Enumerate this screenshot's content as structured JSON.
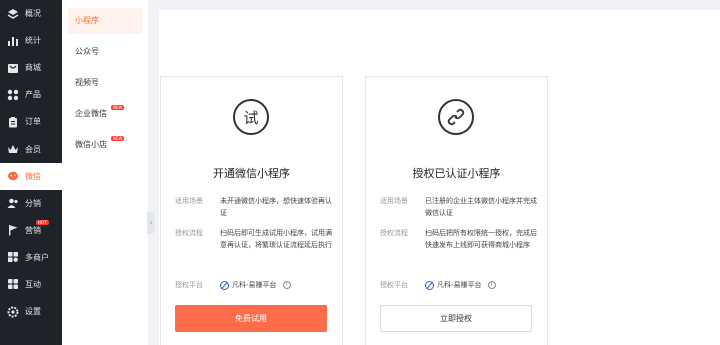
{
  "nav": {
    "items": [
      {
        "label": "概况",
        "icon": "layers-icon"
      },
      {
        "label": "统计",
        "icon": "bar-chart-icon"
      },
      {
        "label": "商城",
        "icon": "store-icon"
      },
      {
        "label": "产品",
        "icon": "grid-icon"
      },
      {
        "label": "订单",
        "icon": "clipboard-icon"
      },
      {
        "label": "会员",
        "icon": "crown-icon"
      },
      {
        "label": "微信",
        "icon": "wechat-icon"
      },
      {
        "label": "分销",
        "icon": "users-icon"
      },
      {
        "label": "营销",
        "icon": "flag-icon",
        "badge": "HOT"
      },
      {
        "label": "多商户",
        "icon": "shops-icon"
      },
      {
        "label": "互动",
        "icon": "apps-icon"
      },
      {
        "label": "设置",
        "icon": "gear-icon"
      }
    ],
    "active": "微信"
  },
  "submenu": {
    "items": [
      {
        "label": "小程序"
      },
      {
        "label": "公众号"
      },
      {
        "label": "视频号"
      },
      {
        "label": "企业微信",
        "badge": "NEW"
      },
      {
        "label": "微信小店",
        "badge": "NEW"
      }
    ],
    "active": "小程序"
  },
  "cards": [
    {
      "badge_char": "试",
      "title": "开通微信小程序",
      "scene_label": "适用场景",
      "scene": "未开通微信小程序，想快速体验再认证",
      "flow_label": "授权流程",
      "flow": "扫码后即可生成试用小程序，试用满意再认证，将繁琐认证流程延后执行",
      "platform_label": "授权平台",
      "platform": "凡科-易赚平台",
      "button": "免费试用"
    },
    {
      "badge_icon": "link-icon",
      "title": "授权已认证小程序",
      "scene_label": "适用场景",
      "scene": "已注册的企业主体微信小程序并完成微信认证",
      "flow_label": "授权流程",
      "flow": "扫码后把所有权限统一授权，完成后快速发布上线即可获得商城小程序",
      "platform_label": "授权平台",
      "platform": "凡科-易赚平台",
      "button": "立即授权"
    }
  ],
  "colors": {
    "accent": "#ff6c4a",
    "nav_bg": "#1f2229",
    "sub_active_bg": "#fff1eb"
  }
}
